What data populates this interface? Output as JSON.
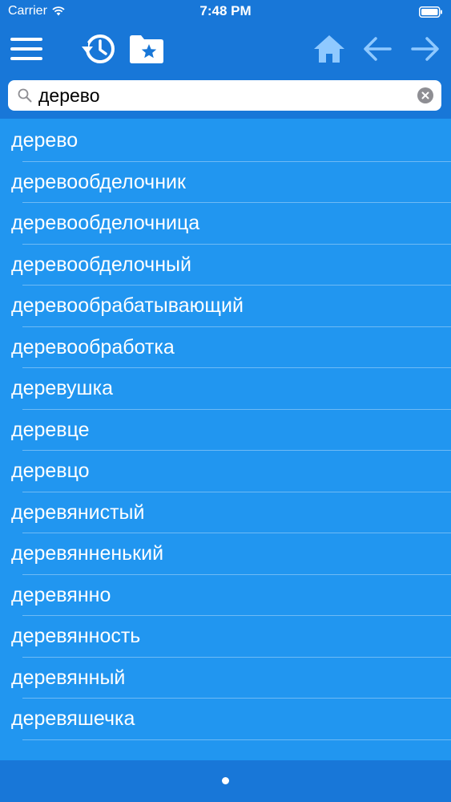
{
  "status_bar": {
    "carrier": "Carrier",
    "time": "7:48 PM"
  },
  "toolbar": {
    "icons": [
      "menu-icon",
      "history-icon",
      "bookmarks-folder-icon",
      "home-icon",
      "arrow-left-icon",
      "arrow-right-icon"
    ],
    "accent_color": "#8fc9ff"
  },
  "search": {
    "value": "дерево"
  },
  "results": [
    "дерево",
    "деревообделочник",
    "деревообделочница",
    "деревообделочный",
    "деревообрабатывающий",
    "деревообработка",
    "деревушка",
    "деревце",
    "деревцо",
    "деревянистый",
    "деревянненький",
    "деревянно",
    "деревянность",
    "деревянный",
    "деревяшечка"
  ],
  "colors": {
    "toolbar_background": "#1877d8",
    "list_background": "#2196f0",
    "text": "#ffffff"
  }
}
